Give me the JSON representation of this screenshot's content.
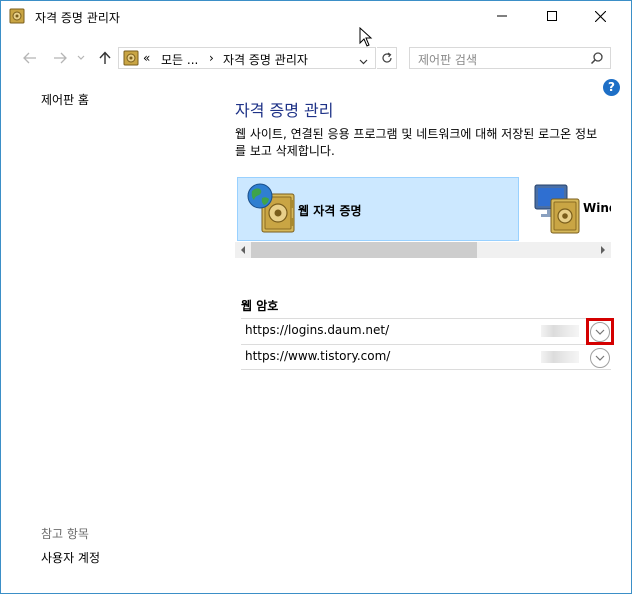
{
  "window": {
    "title": "자격 증명 관리자"
  },
  "address": {
    "chevrons": "«",
    "segment1": "모든 ...",
    "separator": "›",
    "segment2": "자격 증명 관리자"
  },
  "search": {
    "placeholder": "제어판 검색"
  },
  "sidebar": {
    "home": "제어판 홈",
    "see_also_heading": "참고 항목",
    "see_also_items": [
      "사용자 계정"
    ]
  },
  "main": {
    "title": "자격 증명 관리",
    "description": "웹 사이트, 연결된 응용 프로그램 및 네트워크에 대해 저장된 로그온 정보를 보고 삭제합니다.",
    "tiles": [
      {
        "label": "웹 자격 증명",
        "selected": true,
        "icon": "globe-vault-icon"
      },
      {
        "label": "Wind",
        "selected": false,
        "icon": "computer-vault-icon"
      }
    ],
    "section_label": "웹 암호",
    "entries": [
      {
        "url": "https://logins.daum.net/"
      },
      {
        "url": "https://www.tistory.com/"
      }
    ]
  },
  "colors": {
    "accent_title": "#1e3287",
    "tile_selected_bg": "#cce8ff",
    "tile_selected_border": "#99d1ff",
    "highlight": "#d40000",
    "help": "#1e6fc6"
  }
}
